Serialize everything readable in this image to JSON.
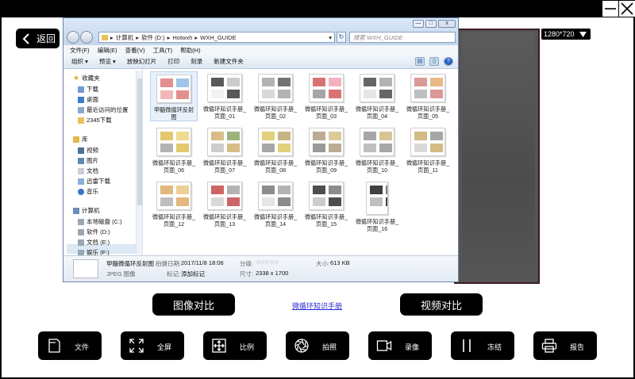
{
  "window": {
    "minimize_icon": "minimize-icon",
    "close_icon": "close-icon"
  },
  "back_button": {
    "label": "返回"
  },
  "resolution": {
    "value": "1280*720"
  },
  "explorer": {
    "address": [
      "计算机",
      "软件 (D:)",
      "Hotwxh",
      "WXH_GUIDE"
    ],
    "search_placeholder": "搜索 WXH_GUIDE",
    "window_controls": [
      "—",
      "□",
      "x"
    ],
    "menu": [
      "文件(F)",
      "编辑(E)",
      "查看(V)",
      "工具(T)",
      "帮助(H)"
    ],
    "toolbar": [
      "组织 ▾",
      "预览 ▾",
      "放映幻灯片",
      "打印",
      "刻录",
      "新建文件夹"
    ],
    "sidebar": {
      "favorites_header": "收藏夹",
      "favorites": [
        "下载",
        "桌面",
        "最近访问的位置",
        "2345下载"
      ],
      "library_header": "库",
      "library": [
        "视频",
        "图片",
        "文档",
        "迅雷下载",
        "音乐"
      ],
      "computer_header": "计算机",
      "computer": [
        "本地磁盘 (C:)",
        "软件 (D:)",
        "文档 (E:)",
        "娱乐 (F:)"
      ]
    },
    "files": [
      {
        "l1": "甲髓微循环反射",
        "l2": "图"
      },
      {
        "l1": "微循环知识手册_",
        "l2": "页面_01"
      },
      {
        "l1": "微循环知识手册_",
        "l2": "页面_02"
      },
      {
        "l1": "微循环知识手册_",
        "l2": "页面_03"
      },
      {
        "l1": "微循环知识手册_",
        "l2": "页面_04"
      },
      {
        "l1": "微循环知识手册_",
        "l2": "页面_05"
      },
      {
        "l1": "微循环知识手册_",
        "l2": "页面_06"
      },
      {
        "l1": "微循环知识手册_",
        "l2": "页面_07"
      },
      {
        "l1": "微循环知识手册_",
        "l2": "页面_08"
      },
      {
        "l1": "微循环知识手册_",
        "l2": "页面_09"
      },
      {
        "l1": "微循环知识手册_",
        "l2": "页面_10"
      },
      {
        "l1": "微循环知识手册_",
        "l2": "页面_11"
      },
      {
        "l1": "微循环知识手册_",
        "l2": "页面_12"
      },
      {
        "l1": "微循环知识手册_",
        "l2": "页面_13"
      },
      {
        "l1": "微循环知识手册_",
        "l2": "页面_14"
      },
      {
        "l1": "微循环知识手册_",
        "l2": "页面_15"
      },
      {
        "l1": "微循环知识手册_",
        "l2": "页面_16"
      }
    ],
    "details": {
      "name": "甲髓微循环反射图",
      "type": "JPEG 图像",
      "date_label": "拍摄日期:",
      "date": "2017/11/8 18:06",
      "tags_label": "标记:",
      "tags": "添加标记",
      "rating_label": "分级:",
      "rating": "☆☆☆☆☆",
      "dims_label": "尺寸:",
      "dims": "2338 x 1700",
      "size_label": "大小:",
      "size": "613 KB"
    }
  },
  "actions": {
    "compare_image": "图像对比",
    "compare_video": "视频对比",
    "manual_link": "微循环知识手册"
  },
  "tools": [
    {
      "label": "文件",
      "icon": "file-icon"
    },
    {
      "label": "全屏",
      "icon": "fullscreen-icon"
    },
    {
      "label": "比例",
      "icon": "ratio-icon"
    },
    {
      "label": "拍照",
      "icon": "camera-shutter-icon"
    },
    {
      "label": "录像",
      "icon": "video-record-icon"
    },
    {
      "label": "冻结",
      "icon": "pause-freeze-icon"
    },
    {
      "label": "报告",
      "icon": "printer-icon"
    }
  ]
}
